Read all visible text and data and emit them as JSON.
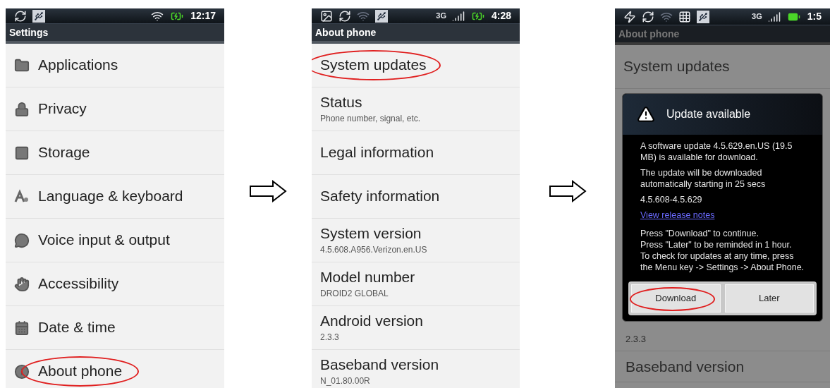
{
  "screens": [
    {
      "dimmed": false,
      "status_bar": {
        "time": "12:17"
      },
      "title": "Settings",
      "items": [
        {
          "title": "Applications",
          "highlighted": false
        },
        {
          "title": "Privacy",
          "highlighted": false
        },
        {
          "title": "Storage",
          "highlighted": false
        },
        {
          "title": "Language & keyboard",
          "highlighted": false
        },
        {
          "title": "Voice input & output",
          "highlighted": false
        },
        {
          "title": "Accessibility",
          "highlighted": false
        },
        {
          "title": "Date & time",
          "highlighted": false
        },
        {
          "title": "About phone",
          "highlighted": true
        }
      ]
    },
    {
      "dimmed": false,
      "status_bar": {
        "network": "3G",
        "time": "4:28"
      },
      "title": "About phone",
      "items": [
        {
          "title": "System updates",
          "highlighted": true
        },
        {
          "title": "Status",
          "subtitle": "Phone number, signal, etc.",
          "highlighted": false
        },
        {
          "title": "Legal information",
          "highlighted": false
        },
        {
          "title": "Safety information",
          "highlighted": false
        },
        {
          "title": "System version",
          "subtitle": "4.5.608.A956.Verizon.en.US",
          "highlighted": false
        },
        {
          "title": "Model number",
          "subtitle": "DROID2 GLOBAL",
          "highlighted": false
        },
        {
          "title": "Android version",
          "subtitle": "2.3.3",
          "highlighted": false
        },
        {
          "title": "Baseband version",
          "subtitle": "N_01.80.00R",
          "highlighted": false
        }
      ]
    },
    {
      "dimmed": true,
      "status_bar": {
        "network": "3G",
        "time": "1:5"
      },
      "title": "About phone",
      "items": [
        {
          "title": "System updates",
          "highlighted": false
        }
      ],
      "dialog": {
        "title": "Update available",
        "paragraphs": [
          "A software update 4.5.629.en.US (19.5 MB) is available for download.",
          "The update will be downloaded automatically starting in 25 secs",
          "4.5.608-4.5.629"
        ],
        "link": "View release notes",
        "instructions": [
          "Press \"Download\" to continue.",
          "Press \"Later\" to be reminded in 1 hour.",
          "To check for updates at any time, press the Menu key -> Settings -> About Phone."
        ],
        "buttons": [
          {
            "label": "Download",
            "highlighted": true
          },
          {
            "label": "Later",
            "highlighted": false
          }
        ]
      },
      "items_below": [
        {
          "subtitle": "2.3.3",
          "highlighted": false
        },
        {
          "title": "Baseband version",
          "highlighted": false
        }
      ]
    }
  ]
}
